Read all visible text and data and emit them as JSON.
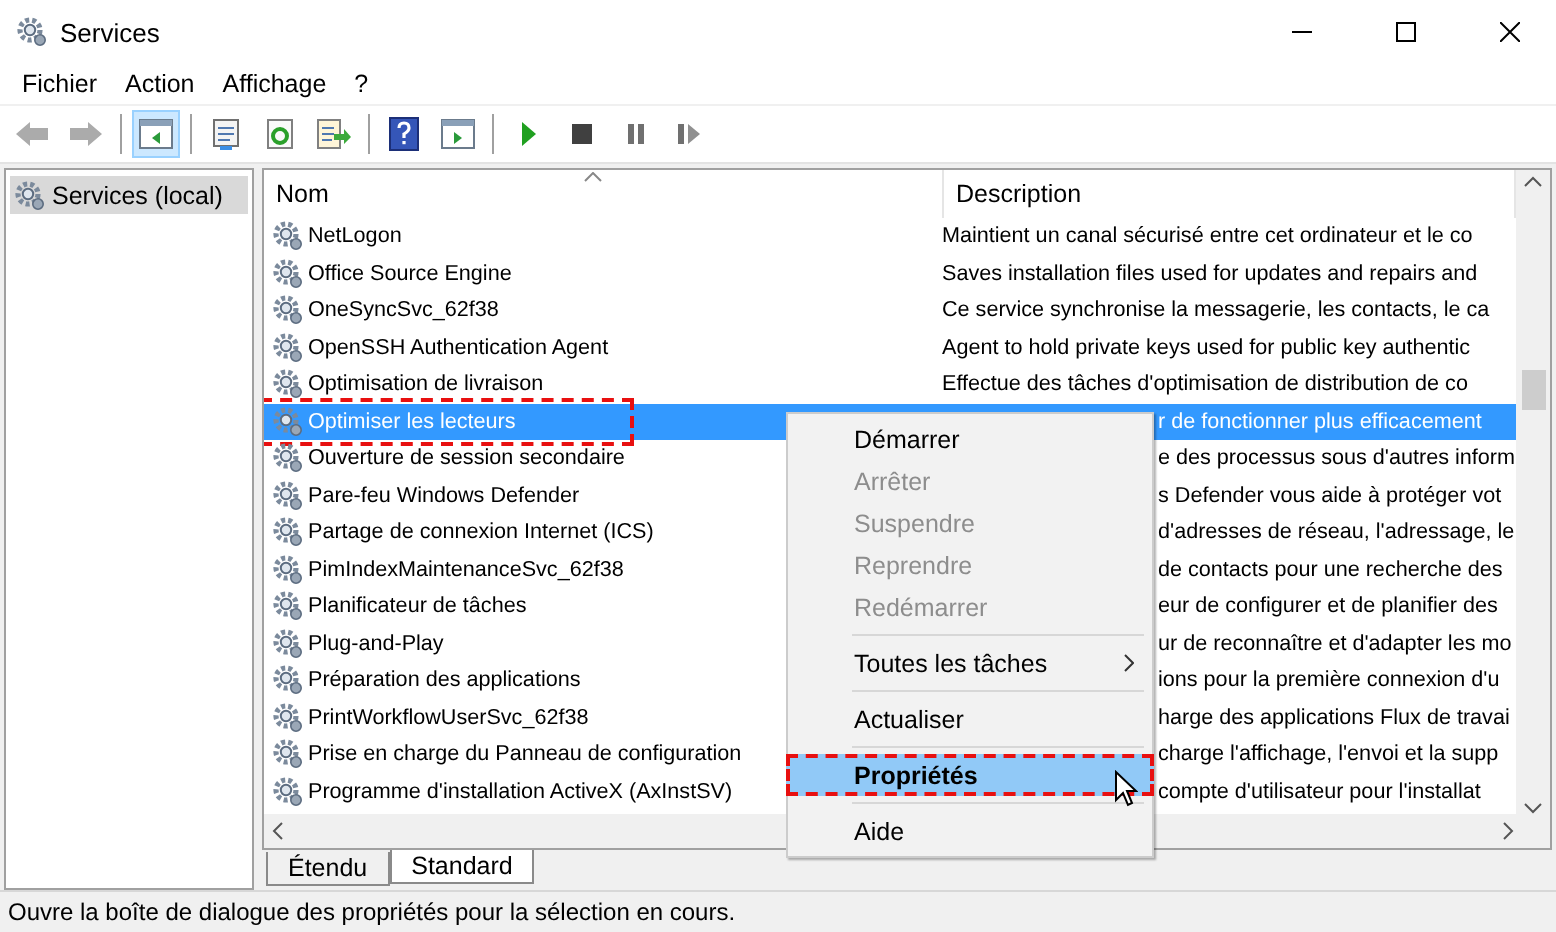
{
  "window": {
    "title": "Services"
  },
  "menu_bar": [
    "Fichier",
    "Action",
    "Affichage",
    "?"
  ],
  "toolbar": [
    {
      "kind": "back",
      "disabled": true,
      "selected": false
    },
    {
      "kind": "forward",
      "disabled": true,
      "selected": false
    },
    {
      "kind": "sep"
    },
    {
      "kind": "tree",
      "disabled": false,
      "selected": true
    },
    {
      "kind": "sep"
    },
    {
      "kind": "properties",
      "disabled": false,
      "selected": false
    },
    {
      "kind": "refresh",
      "disabled": false,
      "selected": false
    },
    {
      "kind": "export",
      "disabled": false,
      "selected": false
    },
    {
      "kind": "sep"
    },
    {
      "kind": "help",
      "disabled": false,
      "selected": false
    },
    {
      "kind": "console",
      "disabled": false,
      "selected": false
    },
    {
      "kind": "sep"
    },
    {
      "kind": "play",
      "disabled": false,
      "selected": false
    },
    {
      "kind": "stop",
      "disabled": false,
      "selected": false
    },
    {
      "kind": "pause",
      "disabled": false,
      "selected": false
    },
    {
      "kind": "resume",
      "disabled": false,
      "selected": false
    }
  ],
  "tree": {
    "items": [
      {
        "label": "Services (local)",
        "selected": true
      }
    ]
  },
  "table": {
    "columns": [
      "Nom",
      "Description"
    ],
    "rows": [
      {
        "name": "NetLogon",
        "description": "Maintient un canal sécurisé entre cet ordinateur et le co",
        "selected": false,
        "under_menu": false
      },
      {
        "name": "Office  Source Engine",
        "description": "Saves installation files used for updates and repairs and",
        "selected": false,
        "under_menu": false
      },
      {
        "name": "OneSyncSvc_62f38",
        "description": "Ce service synchronise la messagerie, les contacts, le ca",
        "selected": false,
        "under_menu": false
      },
      {
        "name": "OpenSSH Authentication Agent",
        "description": "Agent to hold private keys used for public key authentic",
        "selected": false,
        "under_menu": false
      },
      {
        "name": "Optimisation de livraison",
        "description": "Effectue des tâches d'optimisation de distribution de co",
        "selected": false,
        "under_menu": false
      },
      {
        "name": "Optimiser les lecteurs",
        "description": "r de fonctionner plus efficacement",
        "selected": true,
        "under_menu": true
      },
      {
        "name": "Ouverture de session secondaire",
        "description": "e des processus sous d'autres inform",
        "selected": false,
        "under_menu": true
      },
      {
        "name": "Pare-feu Windows Defender",
        "description": "s Defender vous aide à protéger vot",
        "selected": false,
        "under_menu": true
      },
      {
        "name": "Partage de connexion Internet (ICS)",
        "description": "d'adresses de réseau, l'adressage, le",
        "selected": false,
        "under_menu": true
      },
      {
        "name": "PimIndexMaintenanceSvc_62f38",
        "description": "de contacts pour une recherche des",
        "selected": false,
        "under_menu": true
      },
      {
        "name": "Planificateur de tâches",
        "description": "eur de configurer et de planifier des",
        "selected": false,
        "under_menu": true
      },
      {
        "name": "Plug-and-Play",
        "description": "ur de reconnaître et d'adapter les mo",
        "selected": false,
        "under_menu": true
      },
      {
        "name": "Préparation des applications",
        "description": "ions pour la première connexion d'u",
        "selected": false,
        "under_menu": true
      },
      {
        "name": "PrintWorkflowUserSvc_62f38",
        "description": "harge des applications Flux de travai",
        "selected": false,
        "under_menu": true
      },
      {
        "name": "Prise en charge du Panneau de configuration",
        "description": "charge l'affichage, l'envoi et la supp",
        "selected": false,
        "under_menu": true
      },
      {
        "name": "Programme d'installation ActiveX (AxInstSV)",
        "description": "compte d'utilisateur pour l'installat",
        "selected": false,
        "under_menu": true
      }
    ]
  },
  "view_tabs": [
    {
      "label": "Étendu",
      "selected": false
    },
    {
      "label": "Standard",
      "selected": true
    }
  ],
  "context_menu": {
    "groups": [
      [
        {
          "label": "Démarrer",
          "disabled": false,
          "selected": false,
          "default": false,
          "submenu": false
        },
        {
          "label": "Arrêter",
          "disabled": true,
          "selected": false,
          "default": false,
          "submenu": false
        },
        {
          "label": "Suspendre",
          "disabled": true,
          "selected": false,
          "default": false,
          "submenu": false
        },
        {
          "label": "Reprendre",
          "disabled": true,
          "selected": false,
          "default": false,
          "submenu": false
        },
        {
          "label": "Redémarrer",
          "disabled": true,
          "selected": false,
          "default": false,
          "submenu": false
        }
      ],
      [
        {
          "label": "Toutes les tâches",
          "disabled": false,
          "selected": false,
          "default": false,
          "submenu": true
        }
      ],
      [
        {
          "label": "Actualiser",
          "disabled": false,
          "selected": false,
          "default": false,
          "submenu": false
        }
      ],
      [
        {
          "label": "Propriétés",
          "disabled": false,
          "selected": true,
          "default": true,
          "submenu": false
        }
      ],
      [
        {
          "label": "Aide",
          "disabled": false,
          "selected": false,
          "default": false,
          "submenu": false
        }
      ]
    ]
  },
  "status_bar": "Ouvre la boîte de dialogue des propriétés pour la sélection en cours."
}
